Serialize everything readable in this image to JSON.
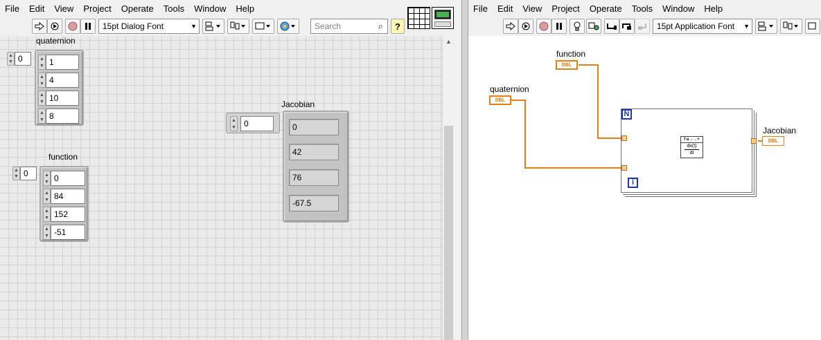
{
  "front_panel": {
    "menu": [
      "File",
      "Edit",
      "View",
      "Project",
      "Operate",
      "Tools",
      "Window",
      "Help"
    ],
    "toolbar": {
      "font_label": "15pt Dialog Font",
      "search_placeholder": "Search"
    },
    "quaternion": {
      "label": "quaternion",
      "index": "0",
      "values": [
        "1",
        "4",
        "10",
        "8"
      ]
    },
    "function": {
      "label": "function",
      "index": "0",
      "values": [
        "0",
        "84",
        "152",
        "-51"
      ]
    },
    "jacobian": {
      "label": "Jacobian",
      "index": "0",
      "values": [
        "0",
        "42",
        "76",
        "-67.5"
      ]
    }
  },
  "block_diagram": {
    "menu": [
      "File",
      "Edit",
      "View",
      "Project",
      "Operate",
      "Tools",
      "Window",
      "Help"
    ],
    "toolbar": {
      "font_label": "15pt Application Font"
    },
    "terminals": {
      "function_label": "function",
      "quaternion_label": "quaternion",
      "jacobian_label": "Jacobian",
      "type_text": "DBL"
    },
    "for_loop": {
      "count_label": "N",
      "iteration_label": "i"
    },
    "derivative_node": {
      "top_text": "f a→→+",
      "formula_top": "dx(t)",
      "formula_bottom": "dt"
    },
    "colors": {
      "dbl_wire": "#e77e10",
      "loop_terminal": "#1d34b8"
    }
  }
}
